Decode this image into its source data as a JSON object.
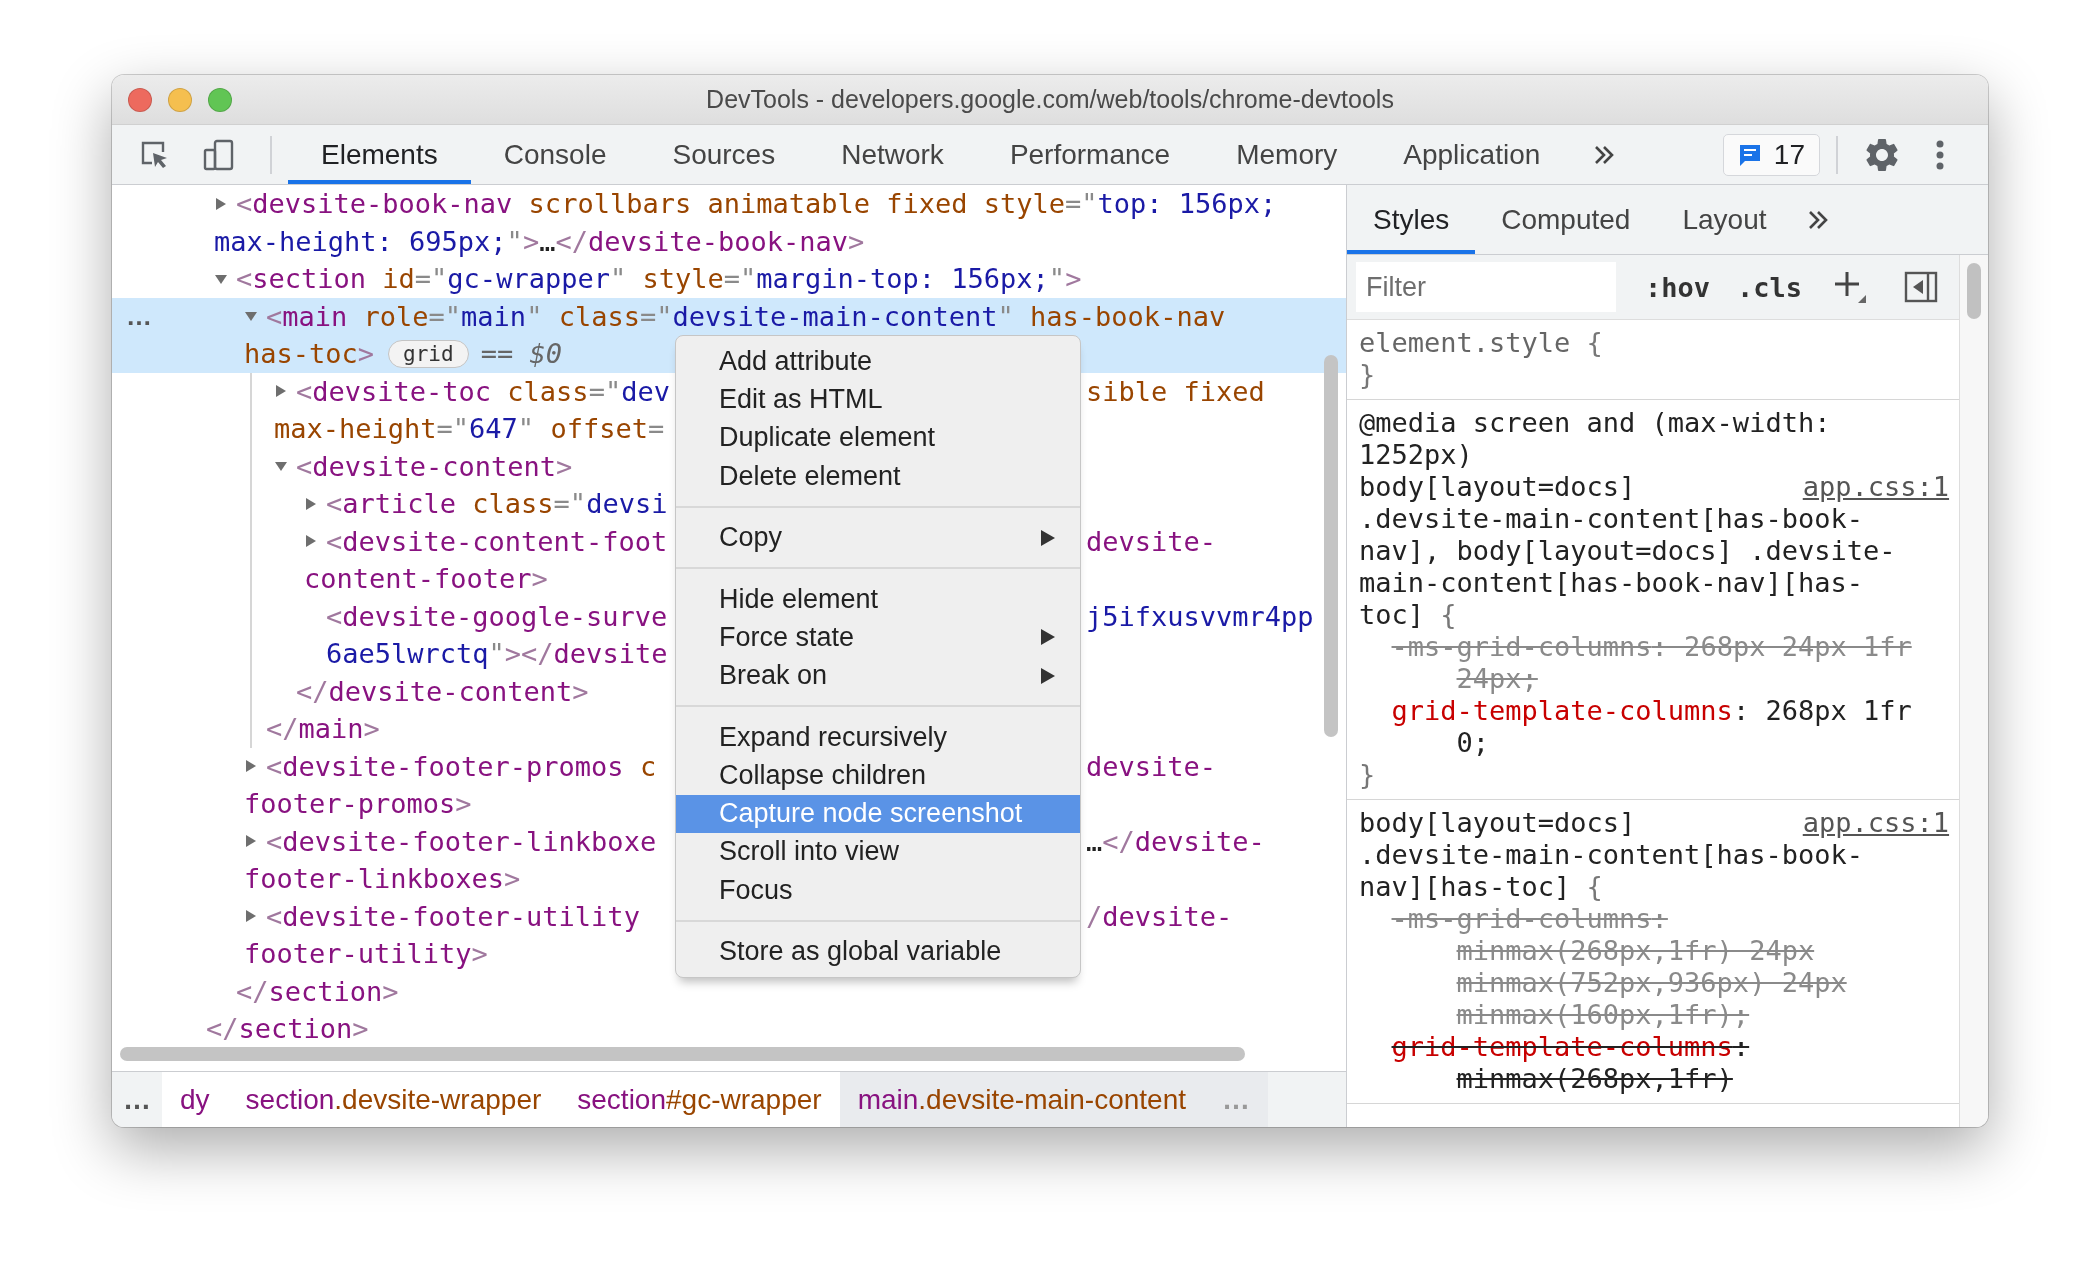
{
  "window": {
    "title": "DevTools - developers.google.com/web/tools/chrome-devtools"
  },
  "toolbar": {
    "tabs": [
      {
        "label": "Elements",
        "selected": true
      },
      {
        "label": "Console",
        "selected": false
      },
      {
        "label": "Sources",
        "selected": false
      },
      {
        "label": "Network",
        "selected": false
      },
      {
        "label": "Performance",
        "selected": false
      },
      {
        "label": "Memory",
        "selected": false
      },
      {
        "label": "Application",
        "selected": false
      }
    ],
    "issues": {
      "count": "17"
    }
  },
  "elements": {
    "tree": {
      "children": [
        {
          "kind": "element",
          "expanded": false,
          "selected": false,
          "lines": [
            {
              "tokens": [
                {
                  "kind": "bracket",
                  "text": "<"
                },
                {
                  "kind": "tag",
                  "text": "devsite-book-nav"
                },
                {
                  "kind": "attr",
                  "text": " scrollbars animatable fixed style"
                },
                {
                  "kind": "punct",
                  "text": "=\""
                },
                {
                  "kind": "value",
                  "text": "top: 156px;"
                }
              ]
            },
            {
              "tokens": [
                {
                  "kind": "value",
                  "text": "max-height: 695px;"
                },
                {
                  "kind": "punct",
                  "text": "\""
                },
                {
                  "kind": "bracket",
                  "text": ">"
                },
                {
                  "kind": "text",
                  "text": "…"
                },
                {
                  "kind": "bracket",
                  "text": "</"
                },
                {
                  "kind": "tag",
                  "text": "devsite-book-nav"
                },
                {
                  "kind": "bracket",
                  "text": ">"
                }
              ]
            }
          ]
        },
        {
          "kind": "element",
          "expanded": true,
          "selected": false,
          "lines": [
            {
              "tokens": [
                {
                  "kind": "bracket",
                  "text": "<"
                },
                {
                  "kind": "tag",
                  "text": "section"
                },
                {
                  "kind": "attr",
                  "text": " id"
                },
                {
                  "kind": "punct",
                  "text": "=\""
                },
                {
                  "kind": "value",
                  "text": "gc-wrapper"
                },
                {
                  "kind": "punct",
                  "text": "\""
                },
                {
                  "kind": "attr",
                  "text": " style"
                },
                {
                  "kind": "punct",
                  "text": "=\""
                },
                {
                  "kind": "value",
                  "text": "margin-top: 156px;"
                },
                {
                  "kind": "punct",
                  "text": "\""
                },
                {
                  "kind": "bracket",
                  "text": ">"
                }
              ]
            }
          ],
          "children": [
            {
              "kind": "element",
              "expanded": true,
              "selected": true,
              "gutter": "…",
              "lines": [
                {
                  "tokens": [
                    {
                      "kind": "bracket",
                      "text": "<"
                    },
                    {
                      "kind": "tag",
                      "text": "main"
                    },
                    {
                      "kind": "attr",
                      "text": " role"
                    },
                    {
                      "kind": "punct",
                      "text": "=\""
                    },
                    {
                      "kind": "value",
                      "text": "main"
                    },
                    {
                      "kind": "punct",
                      "text": "\""
                    },
                    {
                      "kind": "attr",
                      "text": " class"
                    },
                    {
                      "kind": "punct",
                      "text": "=\""
                    },
                    {
                      "kind": "value",
                      "text": "devsite-main-content"
                    },
                    {
                      "kind": "punct",
                      "text": "\""
                    },
                    {
                      "kind": "attr",
                      "text": " has-book-nav"
                    }
                  ]
                },
                {
                  "tokens": [
                    {
                      "kind": "attr",
                      "text": "has-toc"
                    },
                    {
                      "kind": "bracket",
                      "text": ">"
                    },
                    {
                      "kind": "badge",
                      "text": "grid"
                    },
                    {
                      "kind": "hint",
                      "text": "== "
                    },
                    {
                      "kind": "var",
                      "text": "$0"
                    }
                  ]
                }
              ],
              "children": [
                {
                  "kind": "element",
                  "expanded": false,
                  "selected": false,
                  "lines": [
                    {
                      "tokens": [
                        {
                          "kind": "bracket",
                          "text": "<"
                        },
                        {
                          "kind": "tag",
                          "text": "devsite-toc"
                        },
                        {
                          "kind": "attr",
                          "text": " class"
                        },
                        {
                          "kind": "punct",
                          "text": "=\""
                        },
                        {
                          "kind": "value",
                          "text": "dev"
                        }
                      ],
                      "beyond_menu": [
                        {
                          "kind": "attr",
                          "text": "sible fixed"
                        }
                      ]
                    },
                    {
                      "tokens": [
                        {
                          "kind": "attr",
                          "text": "max-height"
                        },
                        {
                          "kind": "punct",
                          "text": "=\""
                        },
                        {
                          "kind": "value",
                          "text": "647"
                        },
                        {
                          "kind": "punct",
                          "text": "\""
                        },
                        {
                          "kind": "attr",
                          "text": " offset"
                        },
                        {
                          "kind": "punct",
                          "text": "="
                        }
                      ]
                    }
                  ]
                },
                {
                  "kind": "element",
                  "expanded": true,
                  "selected": false,
                  "lines": [
                    {
                      "tokens": [
                        {
                          "kind": "bracket",
                          "text": "<"
                        },
                        {
                          "kind": "tag",
                          "text": "devsite-content"
                        },
                        {
                          "kind": "bracket",
                          "text": ">"
                        }
                      ]
                    }
                  ],
                  "children": [
                    {
                      "kind": "element",
                      "expanded": false,
                      "selected": false,
                      "lines": [
                        {
                          "tokens": [
                            {
                              "kind": "bracket",
                              "text": "<"
                            },
                            {
                              "kind": "tag",
                              "text": "article"
                            },
                            {
                              "kind": "attr",
                              "text": " class"
                            },
                            {
                              "kind": "punct",
                              "text": "=\""
                            },
                            {
                              "kind": "value",
                              "text": "devsi"
                            }
                          ]
                        }
                      ]
                    },
                    {
                      "kind": "element",
                      "expanded": false,
                      "selected": false,
                      "lines": [
                        {
                          "tokens": [
                            {
                              "kind": "bracket",
                              "text": "<"
                            },
                            {
                              "kind": "tag",
                              "text": "devsite-content-foot"
                            }
                          ],
                          "beyond_menu": [
                            {
                              "kind": "tag",
                              "text": "devsite-"
                            }
                          ]
                        },
                        {
                          "tokens": [
                            {
                              "kind": "tag",
                              "text": "content-footer"
                            },
                            {
                              "kind": "bracket",
                              "text": ">"
                            }
                          ]
                        }
                      ]
                    },
                    {
                      "kind": "leaf",
                      "selected": false,
                      "lines": [
                        {
                          "tokens": [
                            {
                              "kind": "bracket",
                              "text": "<"
                            },
                            {
                              "kind": "tag",
                              "text": "devsite-google-surve"
                            }
                          ],
                          "beyond_menu": [
                            {
                              "kind": "value",
                              "text": "j5ifxusvvmr4pp"
                            }
                          ]
                        },
                        {
                          "tokens": [
                            {
                              "kind": "value",
                              "text": "6ae5lwrctq"
                            },
                            {
                              "kind": "punct",
                              "text": "\""
                            },
                            {
                              "kind": "bracket",
                              "text": "></"
                            },
                            {
                              "kind": "tag",
                              "text": "devsite"
                            }
                          ]
                        }
                      ]
                    }
                  ],
                  "close": [
                    {
                      "tokens": [
                        {
                          "kind": "bracket",
                          "text": "</"
                        },
                        {
                          "kind": "tag",
                          "text": "devsite-content"
                        },
                        {
                          "kind": "bracket",
                          "text": ">"
                        }
                      ]
                    }
                  ]
                }
              ],
              "close": [
                {
                  "tokens": [
                    {
                      "kind": "bracket",
                      "text": "</"
                    },
                    {
                      "kind": "tag",
                      "text": "main"
                    },
                    {
                      "kind": "bracket",
                      "text": ">"
                    }
                  ]
                }
              ]
            },
            {
              "kind": "element",
              "expanded": false,
              "selected": false,
              "lines": [
                {
                  "tokens": [
                    {
                      "kind": "bracket",
                      "text": "<"
                    },
                    {
                      "kind": "tag",
                      "text": "devsite-footer-promos"
                    },
                    {
                      "kind": "attr",
                      "text": " c"
                    }
                  ],
                  "beyond_menu": [
                    {
                      "kind": "tag",
                      "text": "devsite-"
                    }
                  ]
                },
                {
                  "tokens": [
                    {
                      "kind": "tag",
                      "text": "footer-promos"
                    },
                    {
                      "kind": "bracket",
                      "text": ">"
                    }
                  ]
                }
              ]
            },
            {
              "kind": "element",
              "expanded": false,
              "selected": false,
              "lines": [
                {
                  "tokens": [
                    {
                      "kind": "bracket",
                      "text": "<"
                    },
                    {
                      "kind": "tag",
                      "text": "devsite-footer-linkboxe"
                    }
                  ],
                  "beyond_menu": [
                    {
                      "kind": "text",
                      "text": "…"
                    },
                    {
                      "kind": "bracket",
                      "text": "</"
                    },
                    {
                      "kind": "tag",
                      "text": "devsite-"
                    }
                  ]
                },
                {
                  "tokens": [
                    {
                      "kind": "tag",
                      "text": "footer-linkboxes"
                    },
                    {
                      "kind": "bracket",
                      "text": ">"
                    }
                  ]
                }
              ]
            },
            {
              "kind": "element",
              "expanded": false,
              "selected": false,
              "lines": [
                {
                  "tokens": [
                    {
                      "kind": "bracket",
                      "text": "<"
                    },
                    {
                      "kind": "tag",
                      "text": "devsite-footer-utility"
                    }
                  ],
                  "beyond_menu": [
                    {
                      "kind": "bracket",
                      "text": "/"
                    },
                    {
                      "kind": "tag",
                      "text": "devsite-"
                    }
                  ]
                },
                {
                  "tokens": [
                    {
                      "kind": "tag",
                      "text": "footer-utility"
                    },
                    {
                      "kind": "bracket",
                      "text": ">"
                    }
                  ]
                }
              ]
            }
          ],
          "close": [
            {
              "tokens": [
                {
                  "kind": "bracket",
                  "text": "</"
                },
                {
                  "kind": "tag",
                  "text": "section"
                },
                {
                  "kind": "bracket",
                  "text": ">"
                }
              ]
            }
          ]
        }
      ],
      "close": [
        {
          "tokens": [
            {
              "kind": "bracket",
              "text": "</"
            },
            {
              "kind": "tag",
              "text": "section"
            },
            {
              "kind": "bracket",
              "text": ">"
            }
          ]
        }
      ]
    },
    "context_menu": {
      "groups": [
        {
          "items": [
            {
              "label": "Add attribute",
              "submenu": false,
              "selected": false
            },
            {
              "label": "Edit as HTML",
              "submenu": false,
              "selected": false
            },
            {
              "label": "Duplicate element",
              "submenu": false,
              "selected": false
            },
            {
              "label": "Delete element",
              "submenu": false,
              "selected": false
            }
          ]
        },
        {
          "items": [
            {
              "label": "Copy",
              "submenu": true,
              "selected": false
            }
          ]
        },
        {
          "items": [
            {
              "label": "Hide element",
              "submenu": false,
              "selected": false
            },
            {
              "label": "Force state",
              "submenu": true,
              "selected": false
            },
            {
              "label": "Break on",
              "submenu": true,
              "selected": false
            }
          ]
        },
        {
          "items": [
            {
              "label": "Expand recursively",
              "submenu": false,
              "selected": false
            },
            {
              "label": "Collapse children",
              "submenu": false,
              "selected": false
            },
            {
              "label": "Capture node screenshot",
              "submenu": false,
              "selected": true
            },
            {
              "label": "Scroll into view",
              "submenu": false,
              "selected": false
            },
            {
              "label": "Focus",
              "submenu": false,
              "selected": false
            }
          ]
        },
        {
          "items": [
            {
              "label": "Store as global variable",
              "submenu": false,
              "selected": false
            }
          ]
        }
      ]
    },
    "breadcrumbs": {
      "scroll_left": "…",
      "items": [
        {
          "tag": "dy",
          "selected": false
        },
        {
          "tag": "section",
          "suffix": ".devsite-wrapper",
          "selected": false
        },
        {
          "tag": "section",
          "suffix": "#gc-wrapper",
          "selected": false
        },
        {
          "tag": "main",
          "suffix": ".devsite-main-content",
          "selected": true
        }
      ],
      "scroll_right": "…"
    }
  },
  "styles": {
    "tabs": [
      {
        "label": "Styles",
        "selected": true
      },
      {
        "label": "Computed",
        "selected": false
      },
      {
        "label": "Layout",
        "selected": false
      }
    ],
    "filter": {
      "placeholder": "Filter"
    },
    "hov": ":hov",
    "cls": ".cls",
    "rules": [
      {
        "kind": "inline",
        "selector": "element.style",
        "open_brace": "{",
        "close_brace": "}"
      },
      {
        "kind": "stylesheet",
        "media": "@media screen and (max-width: 1252px)",
        "selector": "body[layout=docs] .devsite-main-content[has-book-nav], body[layout=docs] .devsite-main-content[has-book-nav][has-toc]",
        "open_brace": "{",
        "source": "app.css:1",
        "declarations": [
          {
            "name": "-ms-grid-columns",
            "value": ": 268px 24px 1fr 24px;",
            "inactive": true,
            "overridden": true
          },
          {
            "name": "grid-template-columns",
            "value": ": 268px 1fr 0;",
            "inactive": false,
            "overridden": false
          }
        ],
        "close_brace": "}"
      },
      {
        "kind": "stylesheet",
        "selector": "body[layout=docs] .devsite-main-content[has-book-nav][has-toc]",
        "open_brace": "{",
        "source": "app.css:1",
        "declarations": [
          {
            "name": "-ms-grid-columns",
            "value": ": minmax(268px,1fr) 24px minmax(752px,936px) 24px minmax(160px,1fr);",
            "inactive": true,
            "overridden": true
          },
          {
            "name": "grid-template-columns",
            "value": ": minmax(268px,1fr)",
            "inactive": false,
            "overridden": true
          }
        ]
      }
    ]
  }
}
